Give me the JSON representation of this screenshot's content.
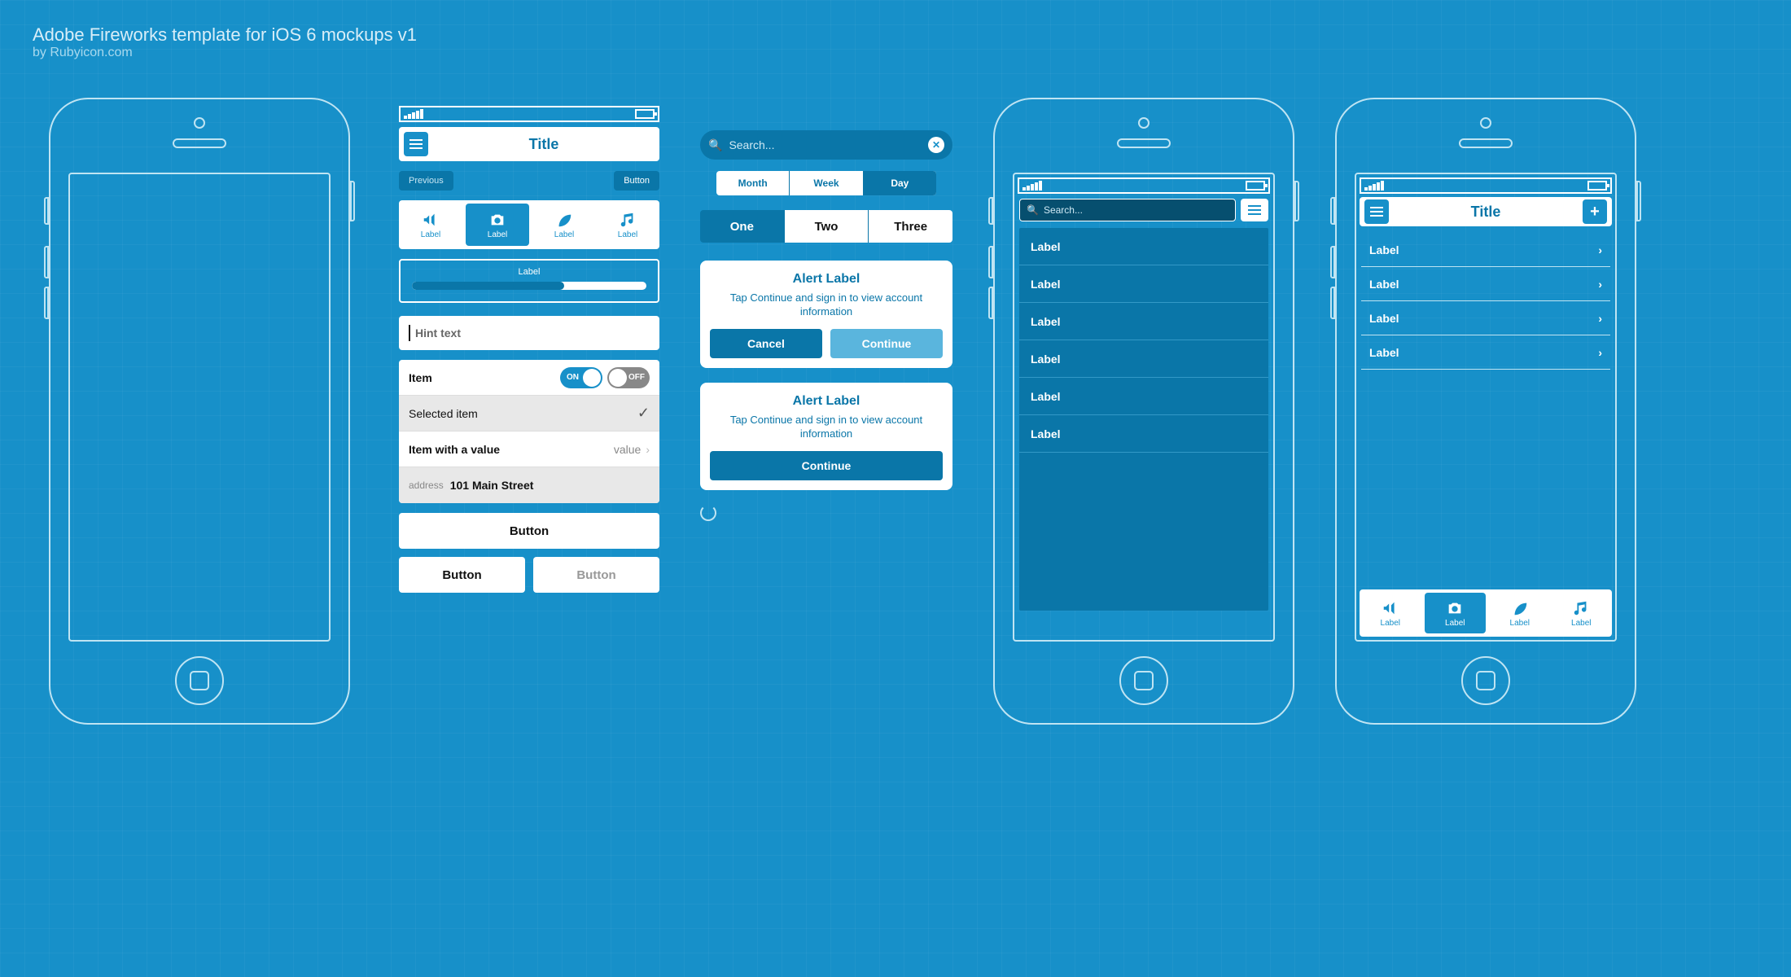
{
  "header": {
    "title": "Adobe Fireworks template for iOS 6 mockups v1",
    "subtitle": "by Rubyicon.com"
  },
  "navbar": {
    "title": "Title"
  },
  "navButtons": {
    "previous": "Previous",
    "button": "Button"
  },
  "tabs": [
    {
      "label": "Label",
      "icon": "megaphone"
    },
    {
      "label": "Label",
      "icon": "camera"
    },
    {
      "label": "Label",
      "icon": "leaf"
    },
    {
      "label": "Label",
      "icon": "music"
    }
  ],
  "progress": {
    "label": "Label"
  },
  "textfield": {
    "hint": "Hint text"
  },
  "list": {
    "item": "Item",
    "on": "ON",
    "off": "OFF",
    "selected": "Selected item",
    "withvalue_k": "Item with a value",
    "withvalue_v": "value",
    "addr_k": "address",
    "addr_v": "101 Main Street"
  },
  "buttons": {
    "big": "Button",
    "left": "Button",
    "right": "Button"
  },
  "search": {
    "placeholder": "Search..."
  },
  "seg1": {
    "a": "Month",
    "b": "Week",
    "c": "Day"
  },
  "seg2": {
    "a": "One",
    "b": "Two",
    "c": "Three"
  },
  "alert1": {
    "title": "Alert Label",
    "body": "Tap Continue and sign in to view account information",
    "cancel": "Cancel",
    "continue": "Continue"
  },
  "alert2": {
    "title": "Alert Label",
    "body": "Tap Continue and sign in to view account information",
    "continue": "Continue"
  },
  "phone3": {
    "search": "Search...",
    "items": [
      "Label",
      "Label",
      "Label",
      "Label",
      "Label",
      "Label"
    ]
  },
  "phone4": {
    "title": "Title",
    "items": [
      "Label",
      "Label",
      "Label",
      "Label"
    ],
    "tabs": [
      "Label",
      "Label",
      "Label",
      "Label"
    ]
  }
}
